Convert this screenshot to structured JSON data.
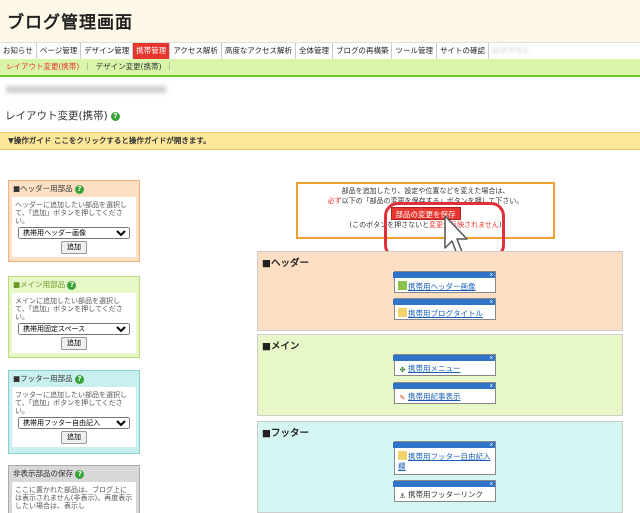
{
  "header": {
    "title": "ブログ管理画面"
  },
  "global_nav": [
    {
      "label": "お知らせ"
    },
    {
      "label": "ページ管理"
    },
    {
      "label": "デザイン管理"
    },
    {
      "label": "携帯管理",
      "active": true
    },
    {
      "label": "アクセス解析"
    },
    {
      "label": "高度なアクセス解析"
    },
    {
      "label": "全体管理"
    },
    {
      "label": "ブログの再構築"
    },
    {
      "label": "ツール管理"
    },
    {
      "label": "サイトの確認"
    },
    {
      "label": "ログアウト"
    }
  ],
  "sub_nav": {
    "layout": "レイアウト変更(携帯)",
    "design": "デザイン変更(携帯)",
    "separator": "｜"
  },
  "page_title": "レイアウト変更(携帯)",
  "help_icon": "?",
  "guide": {
    "text": "▼操作ガイド ここをクリックすると操作ガイドが開きます。"
  },
  "panels": {
    "header": {
      "title": "■ヘッダー用部品",
      "desc": "ヘッダーに追加したい部品を選択して、「追加」ボタンを押してください。",
      "selected": "携帯用ヘッダー画像",
      "add_label": "追加"
    },
    "main": {
      "title": "■メイン用部品",
      "desc": "メインに追加したい部品を選択して、「追加」ボタンを押してください。",
      "selected": "携帯用固定スペース",
      "add_label": "追加"
    },
    "footer": {
      "title": "■フッター用部品",
      "desc": "フッターに追加したい部品を選択して、「追加」ボタンを押してください。",
      "selected": "携帯用フッター自由記入",
      "add_label": "追加"
    },
    "hidden": {
      "title": "非表示部品の保存",
      "desc": "ここに置かれた部品は、ブログ上には表示されません(非表示)。再度表示したい場合は、表示し"
    }
  },
  "notice": {
    "line1": "部品を追加したり、設定や位置などを変えた場合は、",
    "line2_red": "必ず",
    "line2": "以下の「部品の変更を保存する」ボタンを押して下さい。",
    "save_label": "部品の変更を保存",
    "line3_a": "(このボタンを押さないと",
    "line3_red": "変更が反映されません",
    "line3_b": ")"
  },
  "sections": {
    "header": {
      "title": "■ヘッダー",
      "parts": [
        "携帯用ヘッダー画像",
        "携帯用ブログタイトル"
      ]
    },
    "main": {
      "title": "■メイン",
      "parts": [
        "携帯用メニュー",
        "携帯用記事表示"
      ]
    },
    "footer": {
      "title": "■フッター",
      "parts": [
        "携帯用フッター自由記入欄",
        "携帯用フッターリンク"
      ]
    }
  },
  "close_mark": "x",
  "colors": {
    "accent_red": "#e8362e",
    "nav_green": "#6cc62a",
    "part_bar": "#2f74c8"
  }
}
